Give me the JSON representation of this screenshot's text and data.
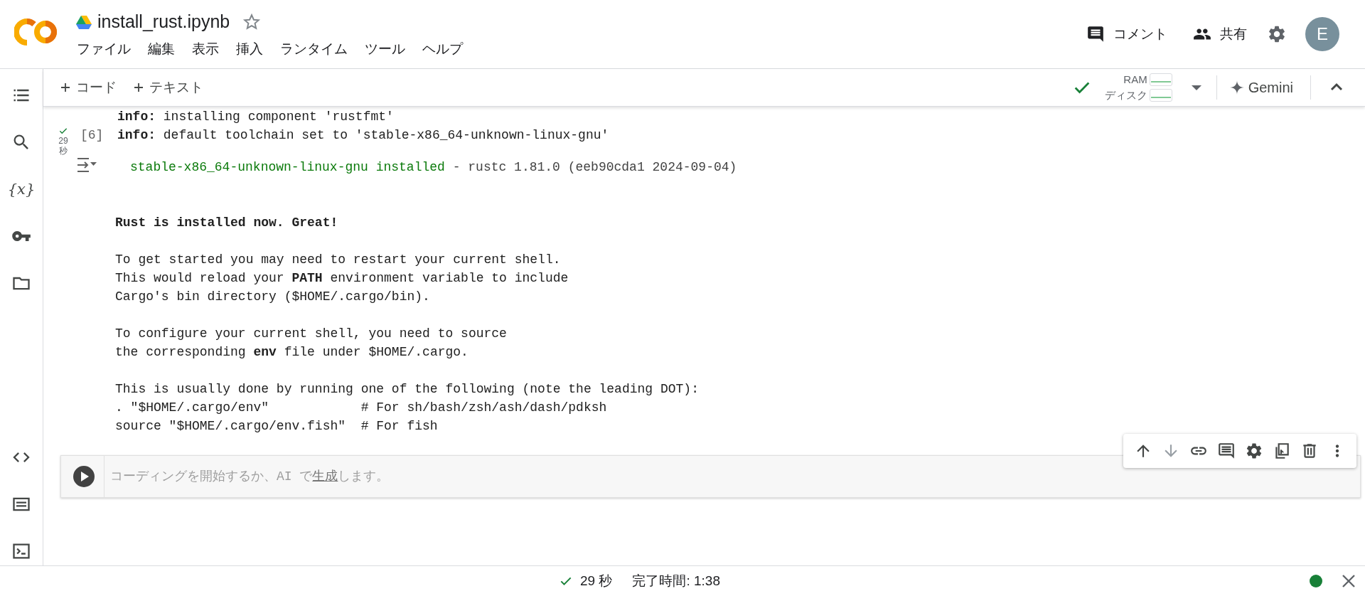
{
  "header": {
    "title": "install_rust.ipynb",
    "starred": false,
    "menu": [
      "ファイル",
      "編集",
      "表示",
      "挿入",
      "ランタイム",
      "ツール",
      "ヘルプ"
    ],
    "actions": [
      {
        "kind": "comment",
        "label": "コメント"
      },
      {
        "kind": "share",
        "label": "共有"
      },
      {
        "kind": "settings"
      }
    ],
    "avatar": "E"
  },
  "toolbar": {
    "add_buttons": [
      "コード",
      "テキスト"
    ],
    "connected": true,
    "ram_label": "RAM",
    "disk_label": "ディスク",
    "gemini": "Gemini"
  },
  "sidebar": {
    "items": [
      {
        "kind": "toc"
      },
      {
        "kind": "search"
      },
      {
        "kind": "variables",
        "glyph": "{x}"
      },
      {
        "kind": "secrets"
      },
      {
        "kind": "files"
      }
    ],
    "bottom_items": [
      {
        "kind": "code"
      },
      {
        "kind": "snippets"
      },
      {
        "kind": "terminal"
      }
    ]
  },
  "cell": {
    "succeeded": true,
    "duration_value": "29",
    "duration_unit": "秒",
    "execution_count": "[6]",
    "log_lines": [
      "**info:** installing component 'rustfmt'",
      "**info:** default toolchain set to 'stable-x86_64-unknown-linux-gnu'"
    ],
    "result_highlight": "stable-x86_64-unknown-linux-gnu installed",
    "result_rest": " - rustc 1.81.0 (eeb90cda1 2024-09-04)",
    "paragraphs": [
      [
        {
          "kind": "bold",
          "text": "Rust is installed now. Great!"
        }
      ],
      [
        {
          "kind": "plain",
          "text": "To get started you may need to restart your current shell."
        },
        {
          "kind": "plain",
          "text": "This would reload your **PATH** environment variable to include"
        },
        {
          "kind": "plain",
          "text": "Cargo's bin directory ($HOME/.cargo/bin)."
        }
      ],
      [
        {
          "kind": "plain",
          "text": "To configure your current shell, you need to source"
        },
        {
          "kind": "plain",
          "text": "the corresponding **env** file under $HOME/.cargo."
        }
      ],
      [
        {
          "kind": "plain",
          "text": "This is usually done by running one of the following (note the leading DOT):"
        },
        {
          "kind": "plain",
          "text": ". \"$HOME/.cargo/env\"            # For sh/bash/zsh/ash/dash/pdksh"
        },
        {
          "kind": "plain",
          "text": "source \"$HOME/.cargo/env.fish\"  # For fish"
        }
      ]
    ]
  },
  "new_cell": {
    "placeholder_before": "コーディングを開始するか、AI で",
    "placeholder_link": "生成",
    "placeholder_after": "します。"
  },
  "cell_toolbar": [
    {
      "kind": "up",
      "disabled": false
    },
    {
      "kind": "down",
      "disabled": true
    },
    {
      "kind": "link",
      "disabled": false
    },
    {
      "kind": "comment",
      "disabled": false
    },
    {
      "kind": "settings",
      "disabled": false
    },
    {
      "kind": "mirror",
      "disabled": false
    },
    {
      "kind": "delete",
      "disabled": false
    },
    {
      "kind": "more",
      "disabled": false
    }
  ],
  "status_bar": {
    "succeeded": true,
    "duration": "29 秒",
    "completed": "完了時間: 1:38",
    "connected": true
  }
}
